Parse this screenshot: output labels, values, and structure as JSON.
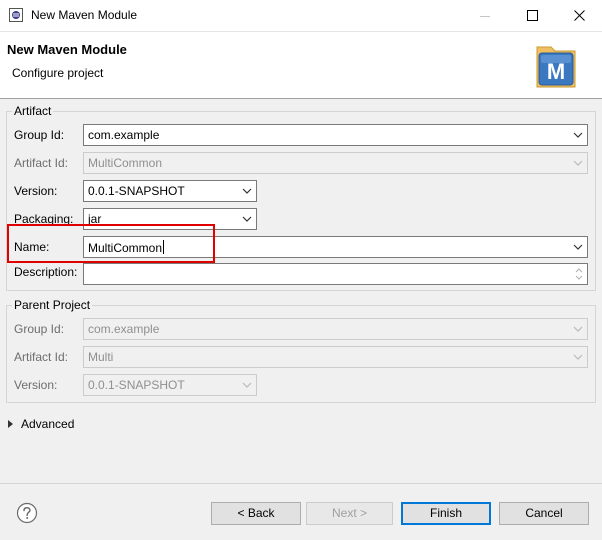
{
  "window": {
    "title": "New Maven Module",
    "icons": [
      "eclipse-icon",
      "minimize-icon",
      "maximize-icon",
      "close-icon"
    ]
  },
  "header": {
    "title": "New Maven Module",
    "subtitle": "Configure project",
    "logo_icon": "maven-logo-icon",
    "logo_letter": "M"
  },
  "artifact": {
    "group_label": "Artifact",
    "group_id_label": "Group Id:",
    "group_id_value": "com.example",
    "artifact_id_label": "Artifact Id:",
    "artifact_id_value": "MultiCommon",
    "version_label": "Version:",
    "version_value": "0.0.1-SNAPSHOT",
    "packaging_label": "Packaging:",
    "packaging_value": "jar",
    "name_label": "Name:",
    "name_value": "MultiCommon",
    "description_label": "Description:",
    "description_value": ""
  },
  "parent": {
    "group_label": "Parent Project",
    "group_id_label": "Group Id:",
    "group_id_value": "com.example",
    "artifact_id_label": "Artifact Id:",
    "artifact_id_value": "Multi",
    "version_label": "Version:",
    "version_value": "0.0.1-SNAPSHOT"
  },
  "advanced": {
    "label": "Advanced"
  },
  "footer": {
    "help_icon": "help-icon",
    "back_label": "< Back",
    "next_label": "Next >",
    "finish_label": "Finish",
    "cancel_label": "Cancel"
  },
  "colors": {
    "highlight_box": "#e00000",
    "default_button_border": "#0078d7",
    "maven_logo_blue": "#3a78c0",
    "maven_folder": "#f0c060"
  }
}
